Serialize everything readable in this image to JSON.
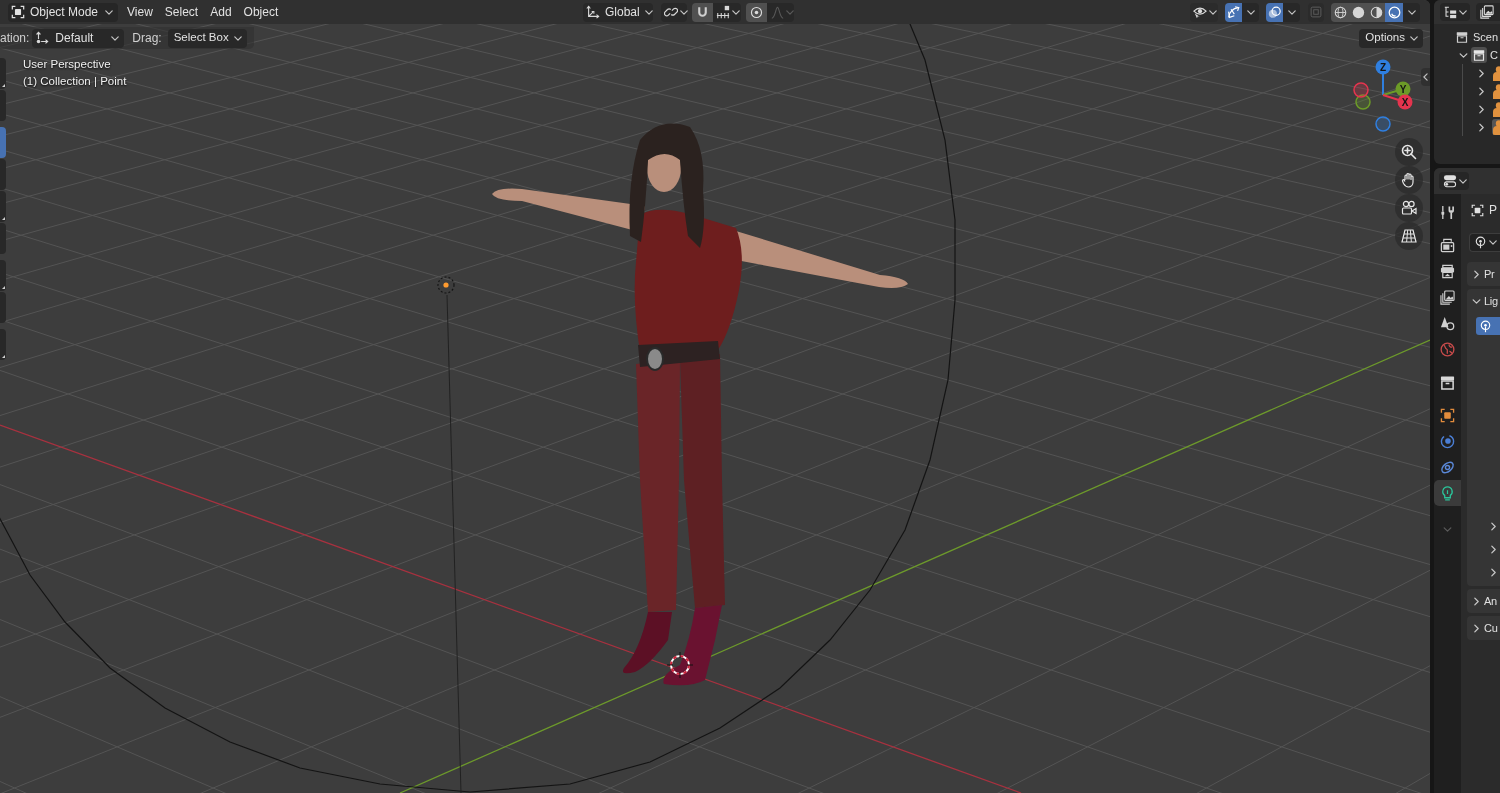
{
  "header": {
    "mode": "Object Mode",
    "menus": [
      {
        "label": "View"
      },
      {
        "label": "Select"
      },
      {
        "label": "Add"
      },
      {
        "label": "Object"
      }
    ],
    "orientation": "Global",
    "snapping": {
      "on": false
    },
    "proportional_editing": {
      "on": false
    },
    "gizmos": {
      "on": true
    },
    "overlays": {
      "on": true
    },
    "xray": {
      "on": false
    },
    "shading": [
      {
        "kind": "wireframe",
        "selected": false
      },
      {
        "kind": "solid",
        "selected": false
      },
      {
        "kind": "material",
        "selected": false
      },
      {
        "kind": "rendered",
        "selected": true
      }
    ]
  },
  "tool_settings": {
    "orientation_label": "ation:",
    "orientation": "Default",
    "drag_label": "Drag:",
    "drag": "Select Box",
    "options": "Options"
  },
  "viewport": {
    "view_name": "User Perspective",
    "object_info": "(1) Collection | Point"
  },
  "toolbar": {
    "groups": [
      {
        "tools": [
          {
            "selected": false,
            "submenu": true
          },
          {
            "selected": false,
            "submenu": false
          }
        ]
      },
      {
        "tools": [
          {
            "selected": true,
            "submenu": false
          },
          {
            "selected": false,
            "submenu": false
          },
          {
            "selected": false,
            "submenu": true
          },
          {
            "selected": false,
            "submenu": false
          }
        ]
      },
      {
        "tools": [
          {
            "selected": false,
            "submenu": true
          },
          {
            "selected": false,
            "submenu": false
          }
        ]
      },
      {
        "tools": [
          {
            "selected": false,
            "submenu": true
          }
        ]
      }
    ]
  },
  "navigation_gizmo": {
    "axes": [
      {
        "label": "Z",
        "color": "#2f7fe0"
      },
      {
        "label": "Y",
        "color": "#6c9b27"
      },
      {
        "label": "X",
        "color": "#e5344e"
      }
    ]
  },
  "outliner": {
    "scene": "Scen",
    "collection": {
      "label": "C",
      "expanded": true
    },
    "objects": [
      {
        "expanded": false,
        "selected": false
      },
      {
        "expanded": false,
        "selected": false
      },
      {
        "expanded": false,
        "selected": false
      },
      {
        "expanded": false,
        "selected": true
      }
    ]
  },
  "properties": {
    "tab_groups": [
      {
        "tabs": [
          {
            "kind": "tool",
            "selected": false
          }
        ]
      },
      {
        "tabs": [
          {
            "kind": "render",
            "selected": false
          },
          {
            "kind": "output",
            "selected": false
          },
          {
            "kind": "view_layer",
            "selected": false
          },
          {
            "kind": "scene",
            "selected": false
          },
          {
            "kind": "world",
            "selected": false
          }
        ]
      },
      {
        "tabs": [
          {
            "kind": "collection",
            "selected": false
          }
        ]
      },
      {
        "tabs": [
          {
            "kind": "object",
            "selected": false
          },
          {
            "kind": "physics",
            "selected": false
          },
          {
            "kind": "constraints",
            "selected": false
          },
          {
            "kind": "data",
            "selected": true
          }
        ]
      }
    ],
    "object_name": "P",
    "panels": [
      {
        "title": "Pr",
        "expanded": false
      },
      {
        "title": "Lig",
        "expanded": true,
        "light_types": [
          {
            "kind": "point",
            "selected": true
          }
        ],
        "subpanels": [
          {
            "expanded": false
          },
          {
            "expanded": false
          },
          {
            "expanded": false
          }
        ]
      },
      {
        "title": "An",
        "expanded": false
      },
      {
        "title": "Cu",
        "expanded": false
      }
    ]
  }
}
